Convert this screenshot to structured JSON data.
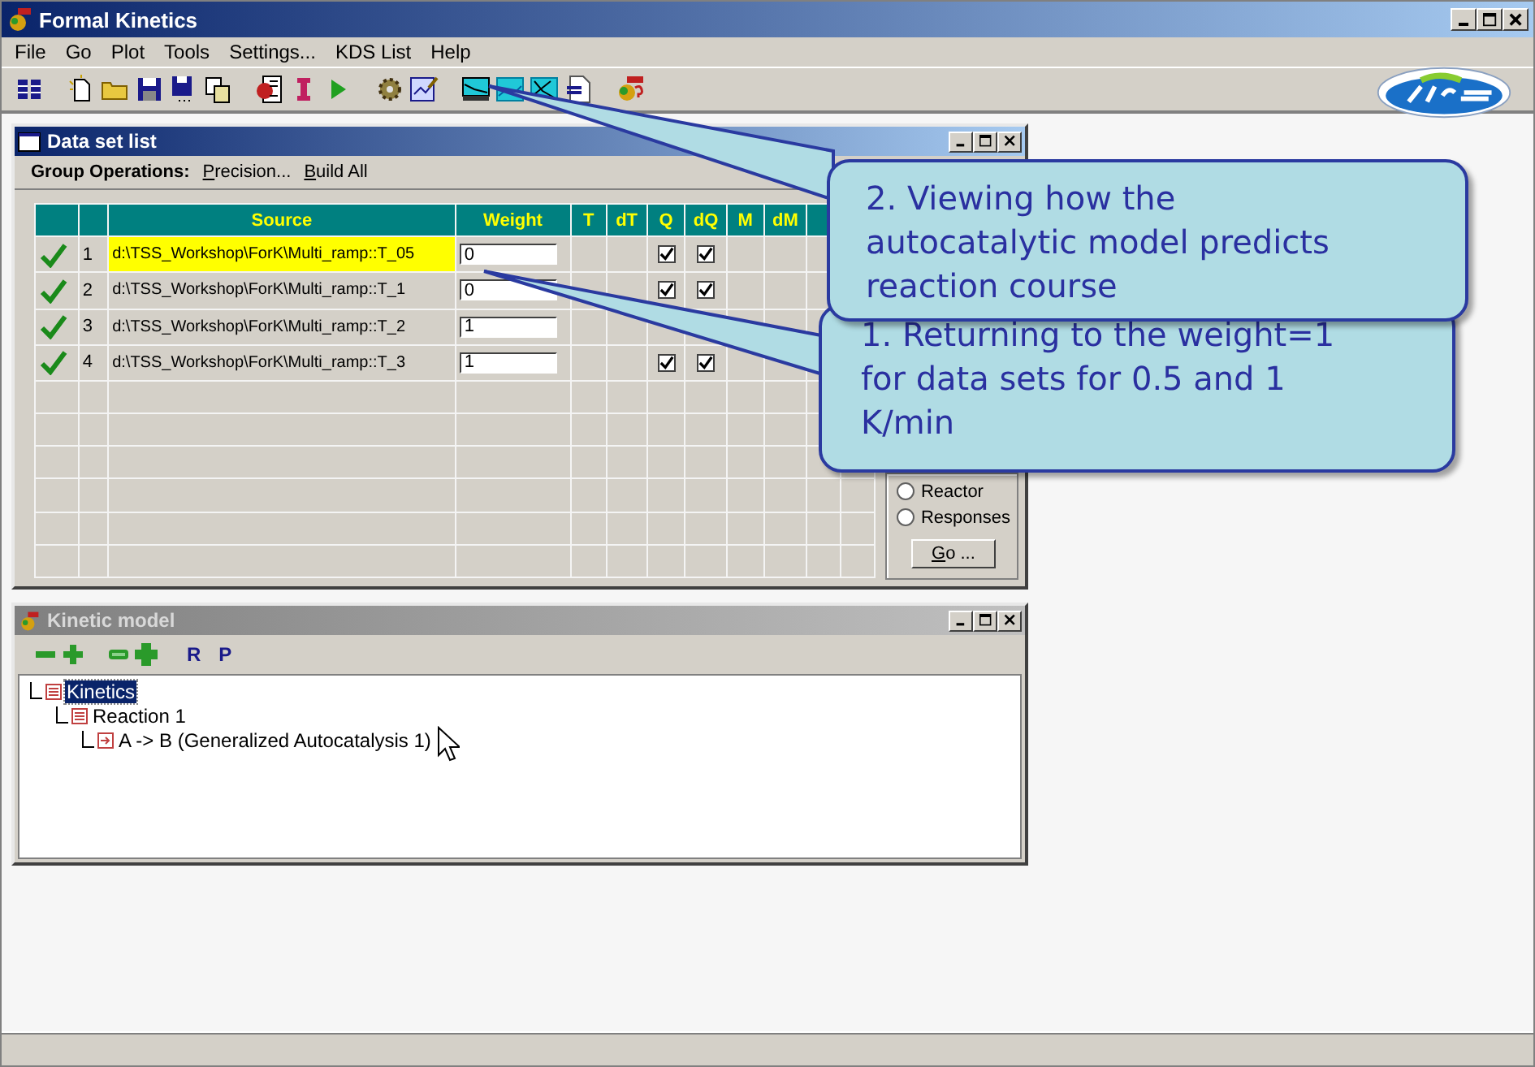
{
  "window": {
    "title": "Formal Kinetics",
    "active": true
  },
  "menu": [
    "File",
    "Go",
    "Plot",
    "Tools",
    "Settings...",
    "KDS List",
    "Help"
  ],
  "data_set_window": {
    "title": "Data set list",
    "active": true,
    "group_operations": {
      "label": "Group Operations:",
      "actions": [
        "Precision...",
        "Build All"
      ]
    },
    "table": {
      "columns": [
        "Source",
        "Weight",
        "T",
        "dT",
        "Q",
        "dQ",
        "M",
        "dM"
      ],
      "rows": [
        {
          "enabled": true,
          "number": "1",
          "source": "d:\\TSS_Workshop\\ForK\\Multi_ramp::T_05",
          "weight": "0",
          "q": true,
          "dq": true,
          "selected": true
        },
        {
          "enabled": true,
          "number": "2",
          "source": "d:\\TSS_Workshop\\ForK\\Multi_ramp::T_1",
          "weight": "0",
          "q": true,
          "dq": true,
          "selected": false
        },
        {
          "enabled": true,
          "number": "3",
          "source": "d:\\TSS_Workshop\\ForK\\Multi_ramp::T_2",
          "weight": "1",
          "q": false,
          "dq": false,
          "selected": false
        },
        {
          "enabled": true,
          "number": "4",
          "source": "d:\\TSS_Workshop\\ForK\\Multi_ramp::T_3",
          "weight": "1",
          "q": true,
          "dq": true,
          "selected": false
        }
      ]
    },
    "display_options": [
      {
        "label": "Reactor",
        "selected": false
      },
      {
        "label": "Responses",
        "selected": false
      }
    ],
    "go_button": "Go ..."
  },
  "kinetic_window": {
    "title": "Kinetic model",
    "active": false,
    "tools": [
      "R",
      "P"
    ],
    "tree": [
      {
        "label": "Kinetics",
        "kind": "group",
        "selected": true,
        "children": [
          {
            "label": "Reaction 1",
            "kind": "group",
            "selected": false,
            "children": [
              {
                "label": "A -> B (Generalized Autocatalysis 1)",
                "kind": "step",
                "selected": false
              }
            ]
          }
        ]
      }
    ]
  },
  "callouts": [
    {
      "text": "2. Viewing how the autocatalytic model predicts reaction course"
    },
    {
      "text": "1. Returning to the weight=1 for data sets for 0.5 and 1 K/min"
    }
  ]
}
